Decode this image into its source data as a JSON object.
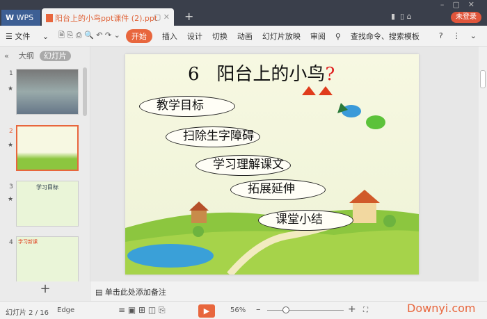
{
  "titlebar": {
    "app_tab": "WPS",
    "doc_tab": "阳台上的小鸟ppt课件 (2).ppt",
    "login": "未登录"
  },
  "toolbar": {
    "file": "文件",
    "items": [
      "开始",
      "插入",
      "设计",
      "切换",
      "动画",
      "幻灯片放映",
      "审阅"
    ],
    "search": "查找命令、搜索模板"
  },
  "panel": {
    "tab_outline": "大纲",
    "tab_slides": "幻灯片",
    "thumbs": [
      {
        "num": "1"
      },
      {
        "num": "2"
      },
      {
        "num": "3",
        "title": "学习目标"
      },
      {
        "num": "4",
        "title": "学习新课"
      }
    ]
  },
  "slide": {
    "number": "6",
    "title": "阳台上的小鸟",
    "question_mark": "?",
    "items": [
      "教学目标",
      "扫除生字障碍",
      "学习理解课文",
      "拓展延伸",
      "课堂小结"
    ]
  },
  "notes": {
    "placeholder": "单击此处添加备注"
  },
  "status": {
    "slide_pos": "幻灯片 2 / 16",
    "theme": "Edge",
    "zoom": "56%",
    "zoom_percent": 56,
    "watermark": "Downyi.com"
  },
  "colors": {
    "accent": "#e8663d",
    "titlebar": "#3a3f4b"
  }
}
